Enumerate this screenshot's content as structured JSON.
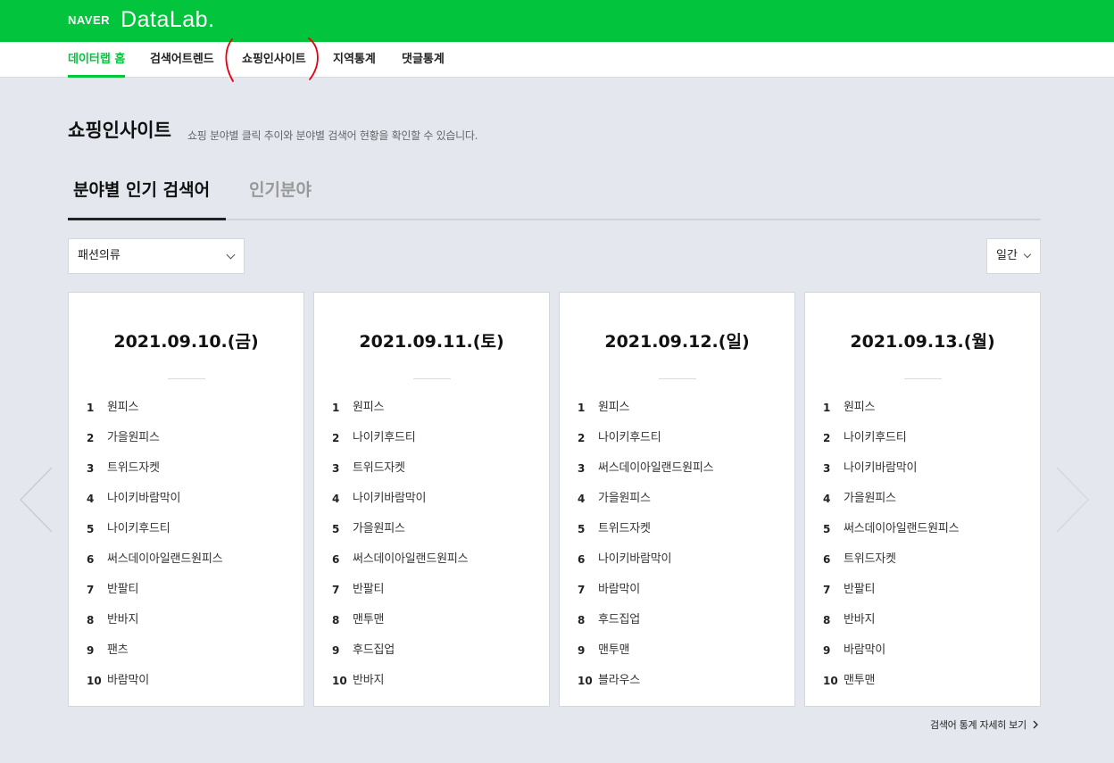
{
  "header": {
    "logo_naver": "NAVER",
    "logo_datalab": "DataLab.",
    "bg_color": "#03c43d"
  },
  "nav": [
    {
      "label": "데이터랩 홈",
      "active": true
    },
    {
      "label": "검색어트렌드",
      "active": false
    },
    {
      "label": "쇼핑인사이트",
      "active": false
    },
    {
      "label": "지역통계",
      "active": false
    },
    {
      "label": "댓글통계",
      "active": false
    }
  ],
  "page": {
    "title": "쇼핑인사이트",
    "description": "쇼핑 분야별 클릭 추이와 분야별 검색어 현황을 확인할 수 있습니다."
  },
  "tabs": [
    {
      "label": "분야별 인기 검색어",
      "active": true
    },
    {
      "label": "인기분야",
      "active": false
    }
  ],
  "filters": {
    "category": "패션의류",
    "period": "일간"
  },
  "cards": [
    {
      "date": "2021.09.10.(금)",
      "items": [
        "원피스",
        "가을원피스",
        "트위드자켓",
        "나이키바람막이",
        "나이키후드티",
        "써스데이아일랜드원피스",
        "반팔티",
        "반바지",
        "팬츠",
        "바람막이"
      ]
    },
    {
      "date": "2021.09.11.(토)",
      "items": [
        "원피스",
        "나이키후드티",
        "트위드자켓",
        "나이키바람막이",
        "가을원피스",
        "써스데이아일랜드원피스",
        "반팔티",
        "맨투맨",
        "후드집업",
        "반바지"
      ]
    },
    {
      "date": "2021.09.12.(일)",
      "items": [
        "원피스",
        "나이키후드티",
        "써스데이아일랜드원피스",
        "가을원피스",
        "트위드자켓",
        "나이키바람막이",
        "바람막이",
        "후드집업",
        "맨투맨",
        "블라우스"
      ]
    },
    {
      "date": "2021.09.13.(월)",
      "items": [
        "원피스",
        "나이키후드티",
        "나이키바람막이",
        "가을원피스",
        "써스데이아일랜드원피스",
        "트위드자켓",
        "반팔티",
        "반바지",
        "바람막이",
        "맨투맨"
      ]
    }
  ],
  "more_link": "검색어 통계 자세히 보기",
  "icons": {
    "prev": "chevron-left-icon",
    "next": "chevron-right-icon",
    "dropdown": "chevron-down-icon",
    "more": "chevron-right-small-icon"
  }
}
